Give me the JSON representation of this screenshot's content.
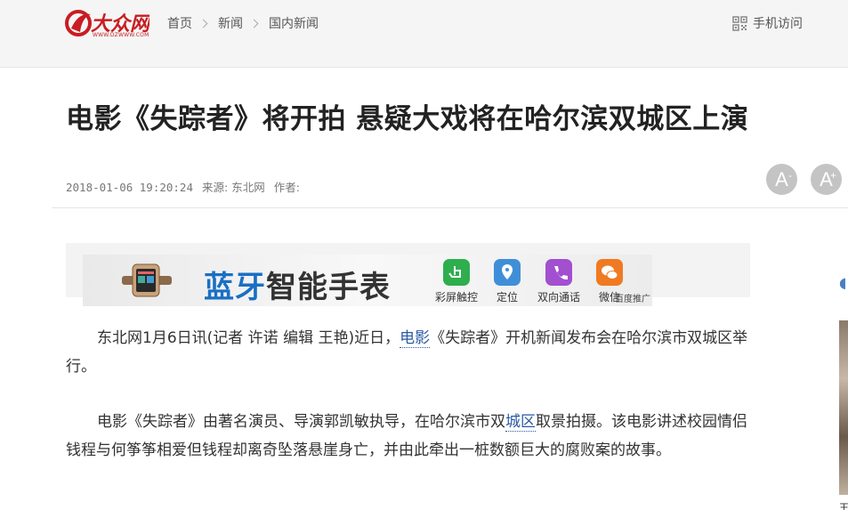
{
  "header": {
    "logo_text": "大众网",
    "logo_url": "WWW.DZWWW.COM",
    "breadcrumb": [
      "首页",
      "新闻",
      "国内新闻"
    ],
    "mobile_visit": "手机访问"
  },
  "article": {
    "title": "电影《失踪者》将开拍 悬疑大戏将在哈尔滨双城区上演",
    "datetime": "2018-01-06 19:20:24",
    "source_label": "来源:",
    "source": "东北网",
    "author_label": "作者:",
    "paragraphs": [
      {
        "before": "东北网1月6日讯(记者 许诺 编辑 王艳)近日，",
        "link": "电影",
        "after": "《失踪者》开机新闻发布会在哈尔滨市双城区举行。"
      },
      {
        "before": "电影《失踪者》由著名演员、导演郭凯敏执导，在哈尔滨市双",
        "link": "城区",
        "after": "取景拍摄。该电影讲述校园情侣钱程与何筝筝相爱但钱程却离奇坠落悬崖身亡，并由此牵出一桩数额巨大的腐败案的故事。"
      }
    ]
  },
  "font_controls": {
    "decrease": "A",
    "decrease_sign": "-",
    "increase": "A",
    "increase_sign": "+"
  },
  "ad": {
    "headline_blue": "蓝牙",
    "headline_dark": "智能手表",
    "features": [
      {
        "label": "彩屏触控",
        "color": "#2fae4e",
        "icon": "touch-icon"
      },
      {
        "label": "定位",
        "color": "#3f8fd8",
        "icon": "location-icon"
      },
      {
        "label": "双向通话",
        "color": "#a24fd0",
        "icon": "phone-icon"
      },
      {
        "label": "微信",
        "color": "#f07a22",
        "icon": "wechat-icon"
      }
    ],
    "tag": "百度推广"
  },
  "side": {
    "char": "王"
  }
}
